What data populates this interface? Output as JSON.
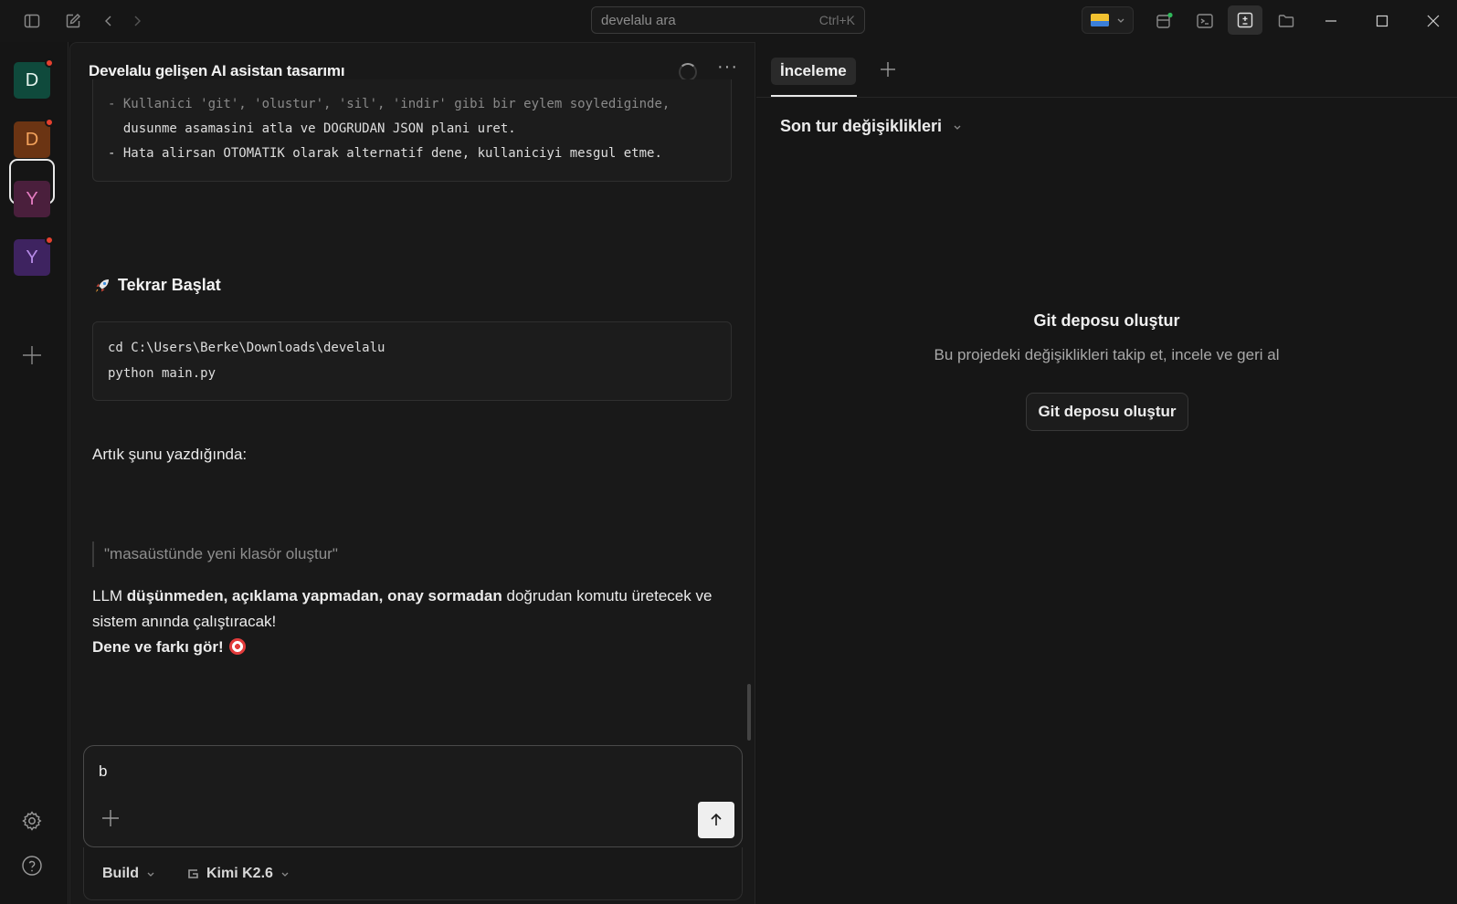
{
  "titlebar": {
    "search_placeholder": "develalu ara",
    "search_shortcut": "Ctrl+K"
  },
  "rail": {
    "projects": [
      {
        "letter": "D",
        "bg": "#0f4a3c",
        "color": "#e7f5ef",
        "notify": true
      },
      {
        "letter": "D",
        "bg": "#6b3413",
        "color": "#f3a25c",
        "notify": true
      },
      {
        "letter": "Y",
        "bg": "#4a1f3c",
        "color": "#e37bc0",
        "notify": false
      },
      {
        "letter": "Y",
        "bg": "#3e2360",
        "color": "#b68be6",
        "notify": true
      }
    ]
  },
  "chat": {
    "title": "Develalu gelişen AI asistan tasarımı",
    "code1": [
      "- Kullanici 'git', 'olustur', 'sil', 'indir' gibi bir eylem soylediginde,",
      "  dusunme asamasini atla ve DOGRUDAN JSON plani uret.",
      "- Hata alirsan OTOMATIK olarak alternatif dene, kullaniciyi mesgul etme."
    ],
    "section_heading": "Tekrar Başlat",
    "code2": [
      "cd C:\\Users\\Berke\\Downloads\\develalu",
      "python main.py"
    ],
    "para1": "Artık şunu yazdığında:",
    "quote": "\"masaüstünde yeni klasör oluştur\"",
    "para2_prefix": "LLM ",
    "para2_bold": "düşünmeden, açıklama yapmadan, onay sormadan",
    "para2_rest1": " doğrudan komutu üretecek ve",
    "para2_rest2": "sistem anında çalıştıracak!",
    "closing": "Dene ve farkı gör!"
  },
  "composer": {
    "text": "b",
    "mode": "Build",
    "model": "Kimi K2.6"
  },
  "right": {
    "tab": "İnceleme",
    "dropdown": "Son tur değişiklikleri",
    "empty_title": "Git deposu oluştur",
    "empty_sub": "Bu projedeki değişiklikleri takip et, incele ve geri al",
    "button": "Git deposu oluştur"
  }
}
